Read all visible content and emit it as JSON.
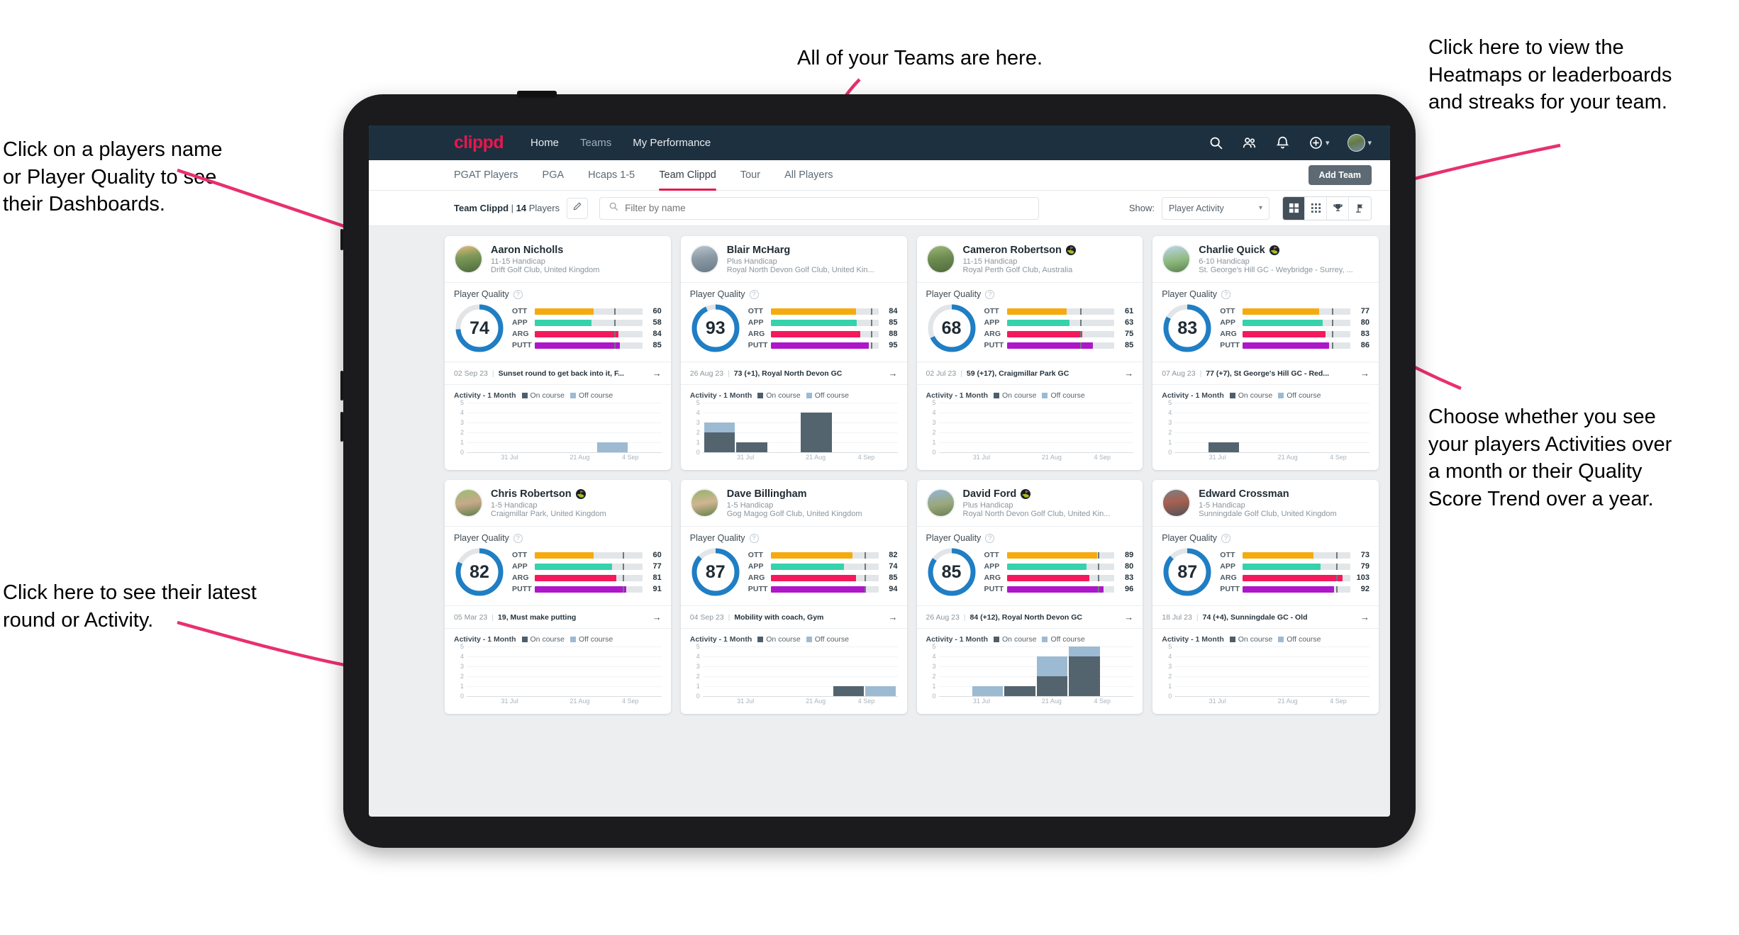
{
  "annotations": [
    {
      "id": "a-teams",
      "text": "All of your Teams are here."
    },
    {
      "id": "a-heatmaps",
      "text": "Click here to view the\nHeatmaps or leaderboards\nand streaks for your team."
    },
    {
      "id": "a-names",
      "text": "Click on a players name\nor Player Quality to see\ntheir Dashboards."
    },
    {
      "id": "a-show",
      "text": "Choose whether you see\nyour players Activities over\na month or their Quality\nScore Trend over a year."
    },
    {
      "id": "a-round",
      "text": "Click here to see their latest\nround or Activity."
    }
  ],
  "topnav": {
    "logo": "clippd",
    "links": [
      {
        "label": "Home",
        "active": true
      },
      {
        "label": "Teams",
        "active": false
      },
      {
        "label": "My Performance",
        "active": true
      }
    ],
    "icons": [
      "search-icon",
      "people-icon",
      "bell-icon",
      "plus-circle-icon",
      "avatar"
    ]
  },
  "tabs": [
    {
      "label": "PGAT Players",
      "active": false
    },
    {
      "label": "PGA",
      "active": false
    },
    {
      "label": "Hcaps 1-5",
      "active": false
    },
    {
      "label": "Team Clippd",
      "active": true
    },
    {
      "label": "Tour",
      "active": false
    },
    {
      "label": "All Players",
      "active": false
    }
  ],
  "add_team_label": "Add Team",
  "filterbar": {
    "team_name": "Team Clippd",
    "separator": " | ",
    "player_count": "14",
    "players_word": " Players",
    "edit_icon": "pencil-icon",
    "search_placeholder": "Filter by name",
    "show_label": "Show:",
    "show_value": "Player Activity",
    "show_options": [
      "Player Activity",
      "Quality Score Trend"
    ],
    "view_buttons": [
      {
        "name": "grid-large-icon",
        "active": true
      },
      {
        "name": "grid-small-icon",
        "active": false
      },
      {
        "name": "trophy-icon",
        "active": false
      },
      {
        "name": "flag-icon",
        "active": false
      }
    ]
  },
  "card_labels": {
    "player_quality": "Player Quality",
    "activity": "Activity - 1 Month",
    "legend_on": "On course",
    "legend_off": "Off course",
    "metrics": [
      "OTT",
      "APP",
      "ARG",
      "PUTT"
    ]
  },
  "colors": {
    "accent": "#e8174e",
    "navbar": "#1d3040",
    "ring": "#1f7ec4",
    "ott": "#f5ab10",
    "app": "#35d2ab",
    "arg": "#f4195d",
    "putt": "#ad17c9",
    "on_course": "#54646f",
    "off_course": "#9dbad3"
  },
  "players": [
    {
      "name": "Aaron Nicholls",
      "verified": false,
      "handicap": "11-15 Handicap",
      "club": "Drift Golf Club, United Kingdom",
      "quality": 74,
      "metrics": [
        {
          "label": "OTT",
          "value": 60,
          "fill": 55,
          "mark": 74
        },
        {
          "label": "APP",
          "value": 58,
          "fill": 53,
          "mark": 74
        },
        {
          "label": "ARG",
          "value": 84,
          "fill": 78,
          "mark": 74
        },
        {
          "label": "PUTT",
          "value": 85,
          "fill": 79,
          "mark": 74
        }
      ],
      "round": {
        "date": "02 Sep 23",
        "text": "Sunset round to get back into it, F..."
      },
      "chart": {
        "yticks": [
          5,
          4,
          3,
          2,
          1,
          0
        ],
        "ymax": 5,
        "xticks": [
          "31 Jul",
          "21 Aug",
          "4 Sep"
        ],
        "bars": [
          {
            "on": 0,
            "off": 0
          },
          {
            "on": 0,
            "off": 0
          },
          {
            "on": 0,
            "off": 0
          },
          {
            "on": 0,
            "off": 0
          },
          {
            "on": 0,
            "off": 1
          },
          {
            "on": 0,
            "off": 0
          }
        ]
      }
    },
    {
      "name": "Blair McHarg",
      "verified": false,
      "handicap": "Plus Handicap",
      "club": "Royal North Devon Golf Club, United Kin...",
      "quality": 93,
      "metrics": [
        {
          "label": "OTT",
          "value": 84,
          "fill": 79,
          "mark": 93
        },
        {
          "label": "APP",
          "value": 85,
          "fill": 80,
          "mark": 93
        },
        {
          "label": "ARG",
          "value": 88,
          "fill": 83,
          "mark": 93
        },
        {
          "label": "PUTT",
          "value": 95,
          "fill": 91,
          "mark": 93
        }
      ],
      "round": {
        "date": "26 Aug 23",
        "text": "73 (+1), Royal North Devon GC"
      },
      "chart": {
        "yticks": [
          5,
          4,
          3,
          2,
          1,
          0
        ],
        "ymax": 5,
        "xticks": [
          "31 Jul",
          "21 Aug",
          "4 Sep"
        ],
        "bars": [
          {
            "on": 2,
            "off": 1
          },
          {
            "on": 1,
            "off": 0
          },
          {
            "on": 0,
            "off": 0
          },
          {
            "on": 4,
            "off": 0
          },
          {
            "on": 0,
            "off": 0
          },
          {
            "on": 0,
            "off": 0
          }
        ]
      }
    },
    {
      "name": "Cameron Robertson",
      "verified": true,
      "handicap": "11-15 Handicap",
      "club": "Royal Perth Golf Club, Australia",
      "quality": 68,
      "metrics": [
        {
          "label": "OTT",
          "value": 61,
          "fill": 56,
          "mark": 68
        },
        {
          "label": "APP",
          "value": 63,
          "fill": 58,
          "mark": 68
        },
        {
          "label": "ARG",
          "value": 75,
          "fill": 70,
          "mark": 68
        },
        {
          "label": "PUTT",
          "value": 85,
          "fill": 80,
          "mark": 68
        }
      ],
      "round": {
        "date": "02 Jul 23",
        "text": "59 (+17), Craigmillar Park GC"
      },
      "chart": {
        "yticks": [
          5,
          4,
          3,
          2,
          1,
          0
        ],
        "ymax": 5,
        "xticks": [
          "31 Jul",
          "21 Aug",
          "4 Sep"
        ],
        "bars": [
          {
            "on": 0,
            "off": 0
          },
          {
            "on": 0,
            "off": 0
          },
          {
            "on": 0,
            "off": 0
          },
          {
            "on": 0,
            "off": 0
          },
          {
            "on": 0,
            "off": 0
          },
          {
            "on": 0,
            "off": 0
          }
        ]
      }
    },
    {
      "name": "Charlie Quick",
      "verified": true,
      "handicap": "6-10 Handicap",
      "club": "St. George's Hill GC - Weybridge - Surrey, ...",
      "quality": 83,
      "metrics": [
        {
          "label": "OTT",
          "value": 77,
          "fill": 71,
          "mark": 83
        },
        {
          "label": "APP",
          "value": 80,
          "fill": 74,
          "mark": 83
        },
        {
          "label": "ARG",
          "value": 83,
          "fill": 77,
          "mark": 83
        },
        {
          "label": "PUTT",
          "value": 86,
          "fill": 80,
          "mark": 83
        }
      ],
      "round": {
        "date": "07 Aug 23",
        "text": "77 (+7), St George's Hill GC - Red..."
      },
      "chart": {
        "yticks": [
          5,
          4,
          3,
          2,
          1,
          0
        ],
        "ymax": 5,
        "xticks": [
          "31 Jul",
          "21 Aug",
          "4 Sep"
        ],
        "bars": [
          {
            "on": 0,
            "off": 0
          },
          {
            "on": 1,
            "off": 0
          },
          {
            "on": 0,
            "off": 0
          },
          {
            "on": 0,
            "off": 0
          },
          {
            "on": 0,
            "off": 0
          },
          {
            "on": 0,
            "off": 0
          }
        ]
      }
    },
    {
      "name": "Chris Robertson",
      "verified": true,
      "handicap": "1-5 Handicap",
      "club": "Craigmillar Park, United Kingdom",
      "quality": 82,
      "metrics": [
        {
          "label": "OTT",
          "value": 60,
          "fill": 55,
          "mark": 82
        },
        {
          "label": "APP",
          "value": 77,
          "fill": 72,
          "mark": 82
        },
        {
          "label": "ARG",
          "value": 81,
          "fill": 76,
          "mark": 82
        },
        {
          "label": "PUTT",
          "value": 91,
          "fill": 85,
          "mark": 82
        }
      ],
      "round": {
        "date": "05 Mar 23",
        "text": "19, Must make putting"
      },
      "chart": {
        "yticks": [
          5,
          4,
          3,
          2,
          1,
          0
        ],
        "ymax": 5,
        "xticks": [
          "31 Jul",
          "21 Aug",
          "4 Sep"
        ],
        "bars": [
          {
            "on": 0,
            "off": 0
          },
          {
            "on": 0,
            "off": 0
          },
          {
            "on": 0,
            "off": 0
          },
          {
            "on": 0,
            "off": 0
          },
          {
            "on": 0,
            "off": 0
          },
          {
            "on": 0,
            "off": 0
          }
        ]
      }
    },
    {
      "name": "Dave Billingham",
      "verified": false,
      "handicap": "1-5 Handicap",
      "club": "Gog Magog Golf Club, United Kingdom",
      "quality": 87,
      "metrics": [
        {
          "label": "OTT",
          "value": 82,
          "fill": 76,
          "mark": 87
        },
        {
          "label": "APP",
          "value": 74,
          "fill": 68,
          "mark": 87
        },
        {
          "label": "ARG",
          "value": 85,
          "fill": 79,
          "mark": 87
        },
        {
          "label": "PUTT",
          "value": 94,
          "fill": 88,
          "mark": 87
        }
      ],
      "round": {
        "date": "04 Sep 23",
        "text": "Mobility with coach, Gym"
      },
      "chart": {
        "yticks": [
          5,
          4,
          3,
          2,
          1,
          0
        ],
        "ymax": 5,
        "xticks": [
          "31 Jul",
          "21 Aug",
          "4 Sep"
        ],
        "bars": [
          {
            "on": 0,
            "off": 0
          },
          {
            "on": 0,
            "off": 0
          },
          {
            "on": 0,
            "off": 0
          },
          {
            "on": 0,
            "off": 0
          },
          {
            "on": 1,
            "off": 0
          },
          {
            "on": 0,
            "off": 1
          }
        ]
      }
    },
    {
      "name": "David Ford",
      "verified": true,
      "handicap": "Plus Handicap",
      "club": "Royal North Devon Golf Club, United Kin...",
      "quality": 85,
      "metrics": [
        {
          "label": "OTT",
          "value": 89,
          "fill": 84,
          "mark": 85
        },
        {
          "label": "APP",
          "value": 80,
          "fill": 74,
          "mark": 85
        },
        {
          "label": "ARG",
          "value": 83,
          "fill": 77,
          "mark": 85
        },
        {
          "label": "PUTT",
          "value": 96,
          "fill": 90,
          "mark": 85
        }
      ],
      "round": {
        "date": "26 Aug 23",
        "text": "84 (+12), Royal North Devon GC"
      },
      "chart": {
        "yticks": [
          5,
          4,
          3,
          2,
          1,
          0
        ],
        "ymax": 5,
        "xticks": [
          "31 Jul",
          "21 Aug",
          "4 Sep"
        ],
        "bars": [
          {
            "on": 0,
            "off": 0
          },
          {
            "on": 0,
            "off": 1
          },
          {
            "on": 1,
            "off": 0
          },
          {
            "on": 2,
            "off": 2
          },
          {
            "on": 4,
            "off": 1
          },
          {
            "on": 0,
            "off": 0
          }
        ]
      }
    },
    {
      "name": "Edward Crossman",
      "verified": false,
      "handicap": "1-5 Handicap",
      "club": "Sunningdale Golf Club, United Kingdom",
      "quality": 87,
      "metrics": [
        {
          "label": "OTT",
          "value": 73,
          "fill": 66,
          "mark": 87
        },
        {
          "label": "APP",
          "value": 79,
          "fill": 72,
          "mark": 87
        },
        {
          "label": "ARG",
          "value": 103,
          "fill": 93,
          "mark": 87
        },
        {
          "label": "PUTT",
          "value": 92,
          "fill": 85,
          "mark": 87
        }
      ],
      "round": {
        "date": "18 Jul 23",
        "text": "74 (+4), Sunningdale GC - Old"
      },
      "chart": {
        "yticks": [
          5,
          4,
          3,
          2,
          1,
          0
        ],
        "ymax": 5,
        "xticks": [
          "31 Jul",
          "21 Aug",
          "4 Sep"
        ],
        "bars": [
          {
            "on": 0,
            "off": 0
          },
          {
            "on": 0,
            "off": 0
          },
          {
            "on": 0,
            "off": 0
          },
          {
            "on": 0,
            "off": 0
          },
          {
            "on": 0,
            "off": 0
          },
          {
            "on": 0,
            "off": 0
          }
        ]
      }
    }
  ]
}
